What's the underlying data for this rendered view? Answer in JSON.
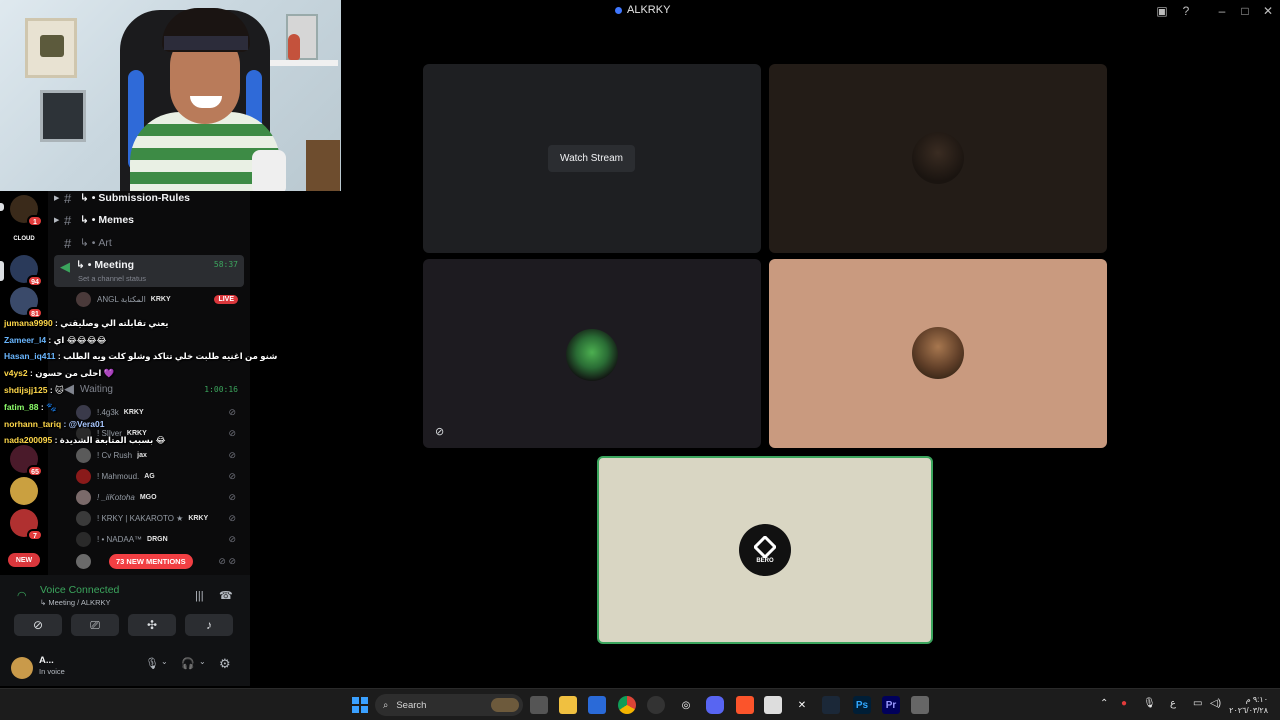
{
  "window": {
    "title": "ALKRKY"
  },
  "channels": [
    {
      "label": "Submission-Rules",
      "prefix": "↳ •"
    },
    {
      "label": "Memes",
      "prefix": "↳ •"
    },
    {
      "label": "Art",
      "prefix": "↳ •"
    }
  ],
  "active_channel": {
    "label": "Meeting",
    "prefix": "↳ •",
    "timer": "58:37",
    "status": "Set a channel status"
  },
  "waiting_channel": {
    "label": "Waiting",
    "timer": "1:00:16"
  },
  "voice_users": [
    {
      "name": "ANGL المكتابة",
      "tag": "KRKY",
      "live": "LIVE"
    },
    {
      "name": "!.4g3k",
      "tag": "KRKY"
    },
    {
      "name": "! SIlver",
      "tag": "KRKY"
    },
    {
      "name": "! Cv Rush",
      "tag": "jax"
    },
    {
      "name": "! Mahmoud.",
      "tag": "AG"
    },
    {
      "name": "! _iiKotoha",
      "tag": "MGO"
    },
    {
      "name": "! KRKY | KAKAROTO ★",
      "tag": "KRKY"
    },
    {
      "name": "! • NADAA™",
      "tag": "DRGN"
    }
  ],
  "mentions": "73 NEW MENTIONS",
  "chat": [
    {
      "name": "jumana9990",
      "text": " : يعني تقابلته الي وصليقتي"
    },
    {
      "name": "Zameer_l4",
      "text": " : اي 😂😂😂😂"
    },
    {
      "name": "Hasan_iq411",
      "text": " : شنو من اغنيه طلبت خلي تتاكد وشلو كلت ويه الطلب"
    },
    {
      "name": "v4ys2",
      "text": " : احلى من حسون 💜"
    },
    {
      "name": "shdijsjj125",
      "text": " : 🐱"
    },
    {
      "name": "fatim_88",
      "text": " : 🐾"
    },
    {
      "name": "norhann_tariq",
      "text": " : @Vera01"
    },
    {
      "name": "nada200095",
      "text": " : بسبب المتابعة الشديدة 😂"
    }
  ],
  "voice_panel": {
    "title": "Voice Connected",
    "subtitle": "↳ Meeting / ALKRKY",
    "user_name": "A...",
    "user_status": "In voice"
  },
  "servers": [
    {
      "label": "",
      "badge": "1",
      "color": "#3a2a1a"
    },
    {
      "label": "CLOUD",
      "badge": "",
      "color": "#000000"
    },
    {
      "label": "",
      "badge": "94",
      "color": "#2a3a5a"
    },
    {
      "label": "",
      "badge": "81",
      "color": "#3a4a6a"
    },
    {
      "label": "",
      "badge": "65",
      "color": "#4a1a2a"
    },
    {
      "label": "",
      "badge": "",
      "color": "#caa040"
    },
    {
      "label": "",
      "badge": "7",
      "color": "#b03030"
    },
    {
      "label": "NEW",
      "badge": "",
      "color": "#da373c"
    }
  ],
  "stage": {
    "watch_label": "Watch Stream",
    "bero_label": "BERO"
  },
  "taskbar": {
    "search_placeholder": "Search",
    "lang": "ع",
    "time": "٩:١٠ م",
    "date": "٢٠٢٦/٠٣/٢٨",
    "apps": [
      "explorer",
      "files",
      "store",
      "chrome",
      "app",
      "steam",
      "discord",
      "brave",
      "app2",
      "x",
      "steam2",
      "Ps",
      "Pr",
      "app3"
    ]
  },
  "colors": {
    "accent": "#3ba55d",
    "live": "#da373c",
    "mention": "#f23f43"
  }
}
